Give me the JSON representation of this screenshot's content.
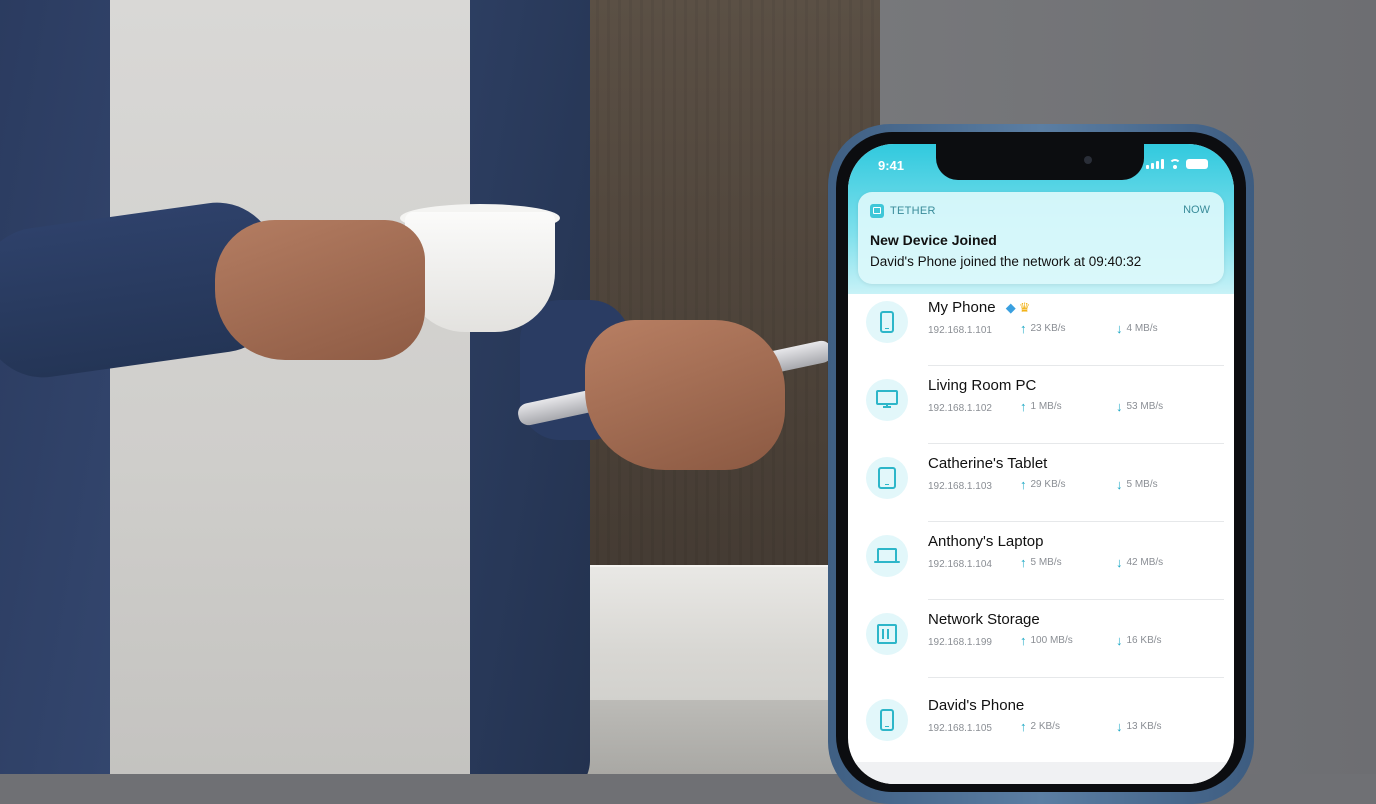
{
  "status_bar": {
    "time": "9:41"
  },
  "notification": {
    "app_name": "TETHER",
    "time": "NOW",
    "title": "New Device Joined",
    "body": "David's Phone joined the network at 09:40:32"
  },
  "devices": [
    {
      "name": "My Phone",
      "ip": "192.168.1.101",
      "up": "23 KB/s",
      "down": "4 MB/s",
      "icon": "phone-icon",
      "badges": [
        "diamond-icon",
        "crown-icon"
      ]
    },
    {
      "name": "Living Room PC",
      "ip": "192.168.1.102",
      "up": "1 MB/s",
      "down": "53 MB/s",
      "icon": "monitor-icon"
    },
    {
      "name": "Catherine's Tablet",
      "ip": "192.168.1.103",
      "up": "29 KB/s",
      "down": "5 MB/s",
      "icon": "tablet-icon"
    },
    {
      "name": "Anthony's Laptop",
      "ip": "192.168.1.104",
      "up": "5 MB/s",
      "down": "42 MB/s",
      "icon": "laptop-icon"
    },
    {
      "name": "Network Storage",
      "ip": "192.168.1.199",
      "up": "100 MB/s",
      "down": "16 KB/s",
      "icon": "storage-icon"
    },
    {
      "name": "David's Phone",
      "ip": "192.168.1.105",
      "up": "2 KB/s",
      "down": "13 KB/s",
      "icon": "phone-icon"
    }
  ],
  "colors": {
    "accent": "#2db6c9",
    "header_gradient_top": "#31c9de",
    "phone_frame": "#4f7196"
  }
}
